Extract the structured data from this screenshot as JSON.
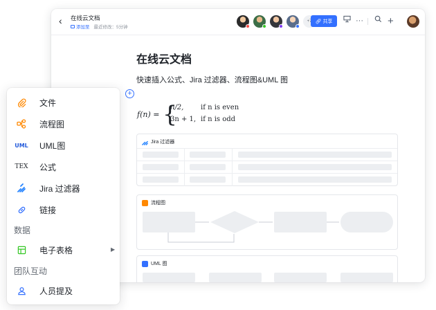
{
  "doc": {
    "back_icon": "chevron-left-icon",
    "title": "在线云文档",
    "tag_label": "添加至",
    "modified": "最近修改：5分钟",
    "collaborator_count": "+7",
    "share_label": "共享",
    "h1": "在线云文档",
    "h3": "快速插入公式、Jira 过滤器、流程图&UML 图",
    "formula": {
      "lhs": "f(n) =",
      "case1_expr": "n/2,",
      "case1_cond": "if n is even",
      "case2_expr": "3n + 1,",
      "case2_cond": "if n is odd"
    },
    "blocks": {
      "jira": "Jira 过滤器",
      "flowchart": "流程图",
      "uml": "UML 图"
    }
  },
  "menu": {
    "items": [
      {
        "label": "文件",
        "icon": "paperclip-icon"
      },
      {
        "label": "流程图",
        "icon": "flowchart-icon"
      },
      {
        "label": "UML图",
        "icon_text": "UML"
      },
      {
        "label": "公式",
        "icon_text": "TEX"
      },
      {
        "label": "Jira 过滤器",
        "icon": "jira-icon"
      },
      {
        "label": "链接",
        "icon": "link-icon"
      }
    ],
    "section_data": "数据",
    "spreadsheet": "电子表格",
    "section_team": "团队互动",
    "mention": "人员提及"
  },
  "colors": {
    "accent": "#3370ff",
    "orange": "#ff8800",
    "green": "#34c724"
  }
}
